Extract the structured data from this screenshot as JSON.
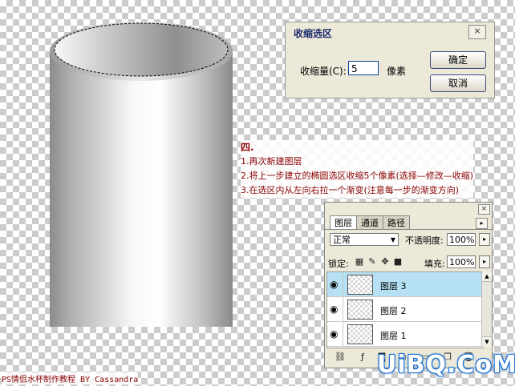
{
  "dialog": {
    "title": "收缩选区",
    "label": "收缩量(C):",
    "value": "5",
    "unit": "像素",
    "ok_label": "确定",
    "cancel_label": "取消",
    "close_label": "×"
  },
  "instructions": {
    "heading": "四.",
    "steps": [
      "1.再次新建图层",
      "2.将上一步建立的椭圆选区收缩5个像素(选择—修改—收缩)",
      "3.在选区内从左向右拉一个渐变(注意每一步的渐变方向)"
    ]
  },
  "layers_panel": {
    "tabs": [
      "图层",
      "通道",
      "路径"
    ],
    "active_tab": "图层",
    "blend_mode": "正常",
    "opacity_label": "不透明度:",
    "opacity": "100%",
    "lock_label": "锁定:",
    "fill_label": "填充:",
    "fill": "100%",
    "layers": [
      {
        "name": "图层 3",
        "selected": true,
        "visible": true
      },
      {
        "name": "图层 2",
        "selected": false,
        "visible": true
      },
      {
        "name": "图层 1",
        "selected": false,
        "visible": true
      }
    ],
    "selected_color": "#b6e1f5"
  },
  "credit": "PS情侣水杯制作教程   BY Cassandra",
  "watermark": "UiBQ.CoM",
  "colors": {
    "instruction_text": "#8b0000",
    "watermark_outline": "#1a6fd1"
  }
}
